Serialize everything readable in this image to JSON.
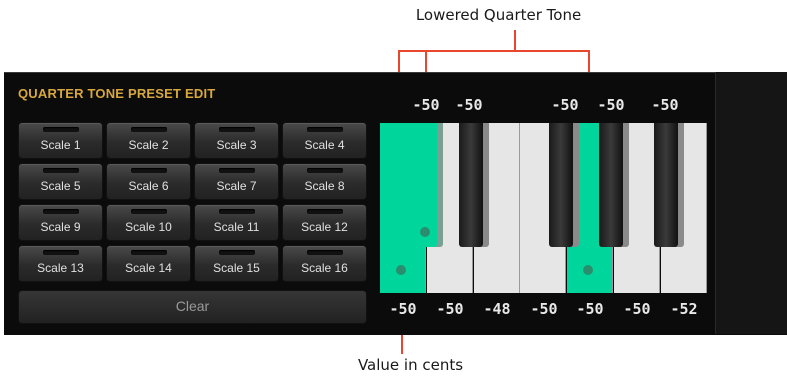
{
  "callouts": {
    "top": "Lowered Quarter Tone",
    "bottom": "Value in cents",
    "line_color": "#e8472b"
  },
  "panel": {
    "title": "QUARTER TONE PRESET EDIT",
    "accent_color": "#d8a73d",
    "selected_key_color": "#00d69b"
  },
  "scales": [
    "Scale 1",
    "Scale  2",
    "Scale 3",
    "Scale 4",
    "Scale 5",
    "Scale 6",
    "Scale 7",
    "Scale 8",
    "Scale 9",
    "Scale 10",
    "Scale 11",
    "Scale 12",
    "Scale 13",
    "Scale 14",
    "Scale 15",
    "Scale 16"
  ],
  "clear_label": "Clear",
  "top_cents": [
    "-50",
    "-50",
    "-50",
    "-50",
    "-50"
  ],
  "bottom_cents": [
    "-50",
    "-50",
    "-48",
    "-50",
    "-50",
    "-50",
    "-52"
  ]
}
